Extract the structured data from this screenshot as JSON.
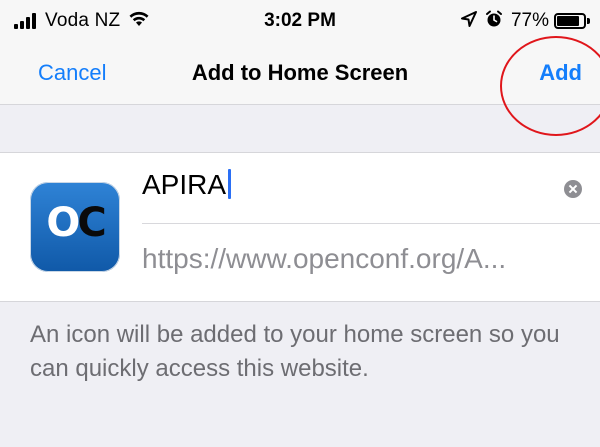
{
  "status_bar": {
    "carrier": "Voda NZ",
    "time": "3:02 PM",
    "battery": "77%"
  },
  "nav": {
    "cancel": "Cancel",
    "title": "Add to Home Screen",
    "add": "Add"
  },
  "app_icon": {
    "letter1": "O",
    "letter2": "C"
  },
  "form": {
    "name_value": "APIRA",
    "url": "https://www.openconf.org/A..."
  },
  "description": "An icon will be added to your home screen so you can quickly access this website.",
  "colors": {
    "accent": "#147efb",
    "annotation": "#e0161b"
  },
  "icons": [
    "signal-icon",
    "wifi-icon",
    "location-arrow-icon",
    "alarm-icon",
    "battery-icon",
    "clear-icon"
  ]
}
